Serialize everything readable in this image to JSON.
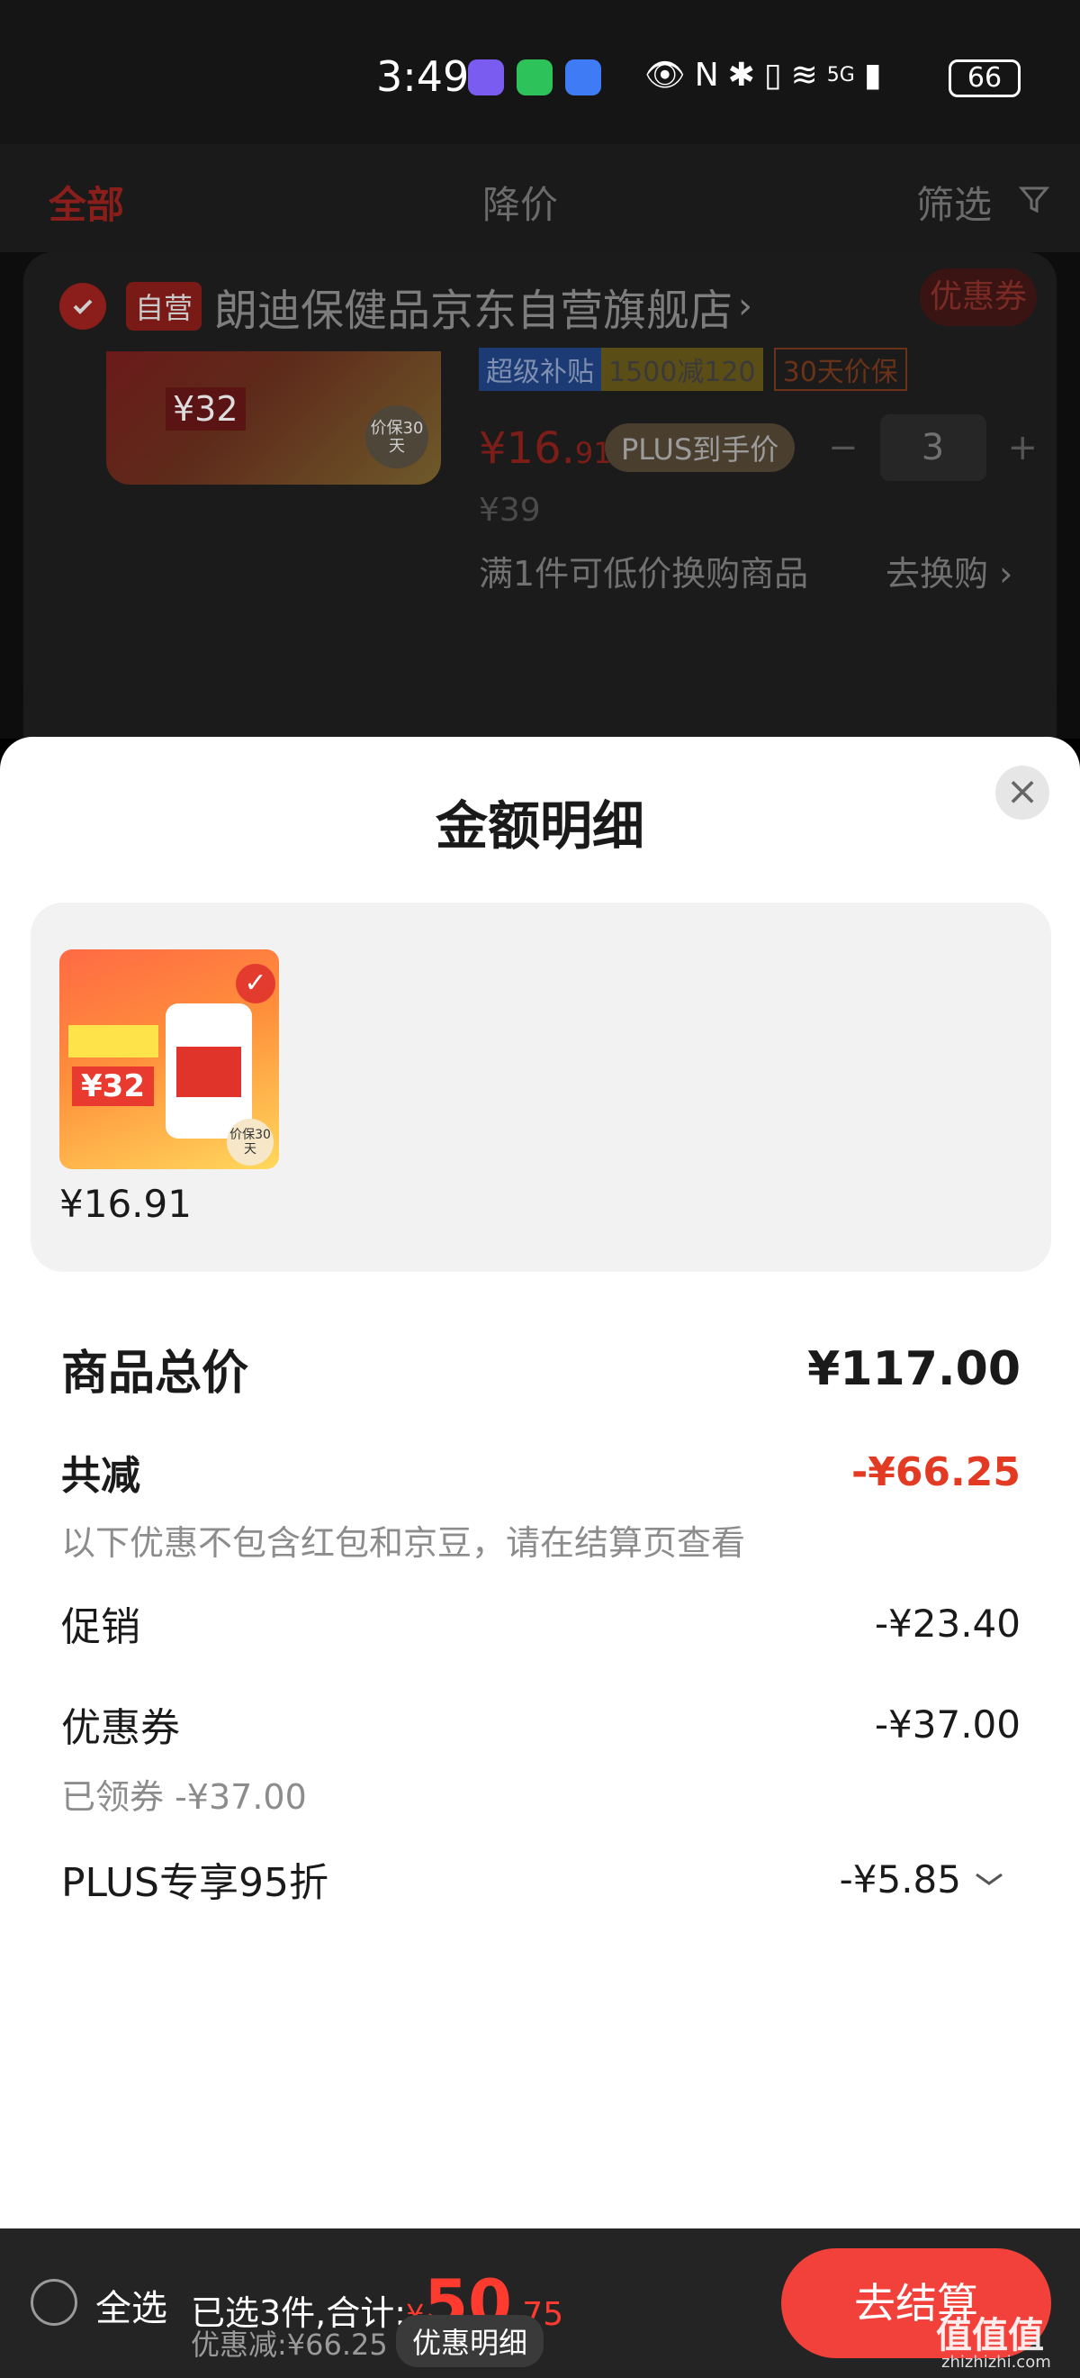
{
  "status_bar": {
    "time": "3:49",
    "network": "5G",
    "battery": "66"
  },
  "cart_bg": {
    "tabs": [
      "全部",
      "降价",
      "筛选"
    ],
    "shop": {
      "self_badge": "自营",
      "name": "朗迪保健品京东自营旗舰店",
      "arrow": "›",
      "coupon": "优惠券"
    },
    "product": {
      "img_price": "¥32",
      "img_badge": "价保30天",
      "tags": [
        "超级补贴",
        "1500减120",
        "30天价保"
      ],
      "price_int": "¥16.",
      "price_dec": "91",
      "plus_label": "PLUS到手价",
      "qty": "3",
      "orig_price": "¥39",
      "exchange_text": "满1件可低价换购商品",
      "exchange_link": "去换购 ›"
    }
  },
  "sheet": {
    "title": "金额明细",
    "close": "×",
    "goods": [
      {
        "price": "¥16.91",
        "img_price": "¥32",
        "img_badge": "价保30天"
      }
    ],
    "total_label": "商品总价",
    "total_value": "¥117.00",
    "reduce_label": "共减",
    "reduce_value": "-¥66.25",
    "reduce_note": "以下优惠不包含红包和京豆，请在结算页查看",
    "promo_label": "促销",
    "promo_value": "-¥23.40",
    "coupon_label": "优惠券",
    "coupon_value": "-¥37.00",
    "coupon_note": "已领券 -¥37.00",
    "plus_label": "PLUS专享95折",
    "plus_value": "-¥5.85"
  },
  "bottom_bar": {
    "select_all": "全选",
    "summary_prefix": "已选3件,合计:",
    "currency": "¥",
    "total_int": "50",
    "total_dec": ".75",
    "discount": "优惠减:¥66.25",
    "detail_button": "优惠明细",
    "checkout": "去结算"
  },
  "watermark": {
    "main": "值值值",
    "sub": "zhizhizhi.com"
  },
  "colors": {
    "accent_red": "#e33a24",
    "checkout_red": "#f2403a",
    "bottom_bar": "#242424"
  }
}
